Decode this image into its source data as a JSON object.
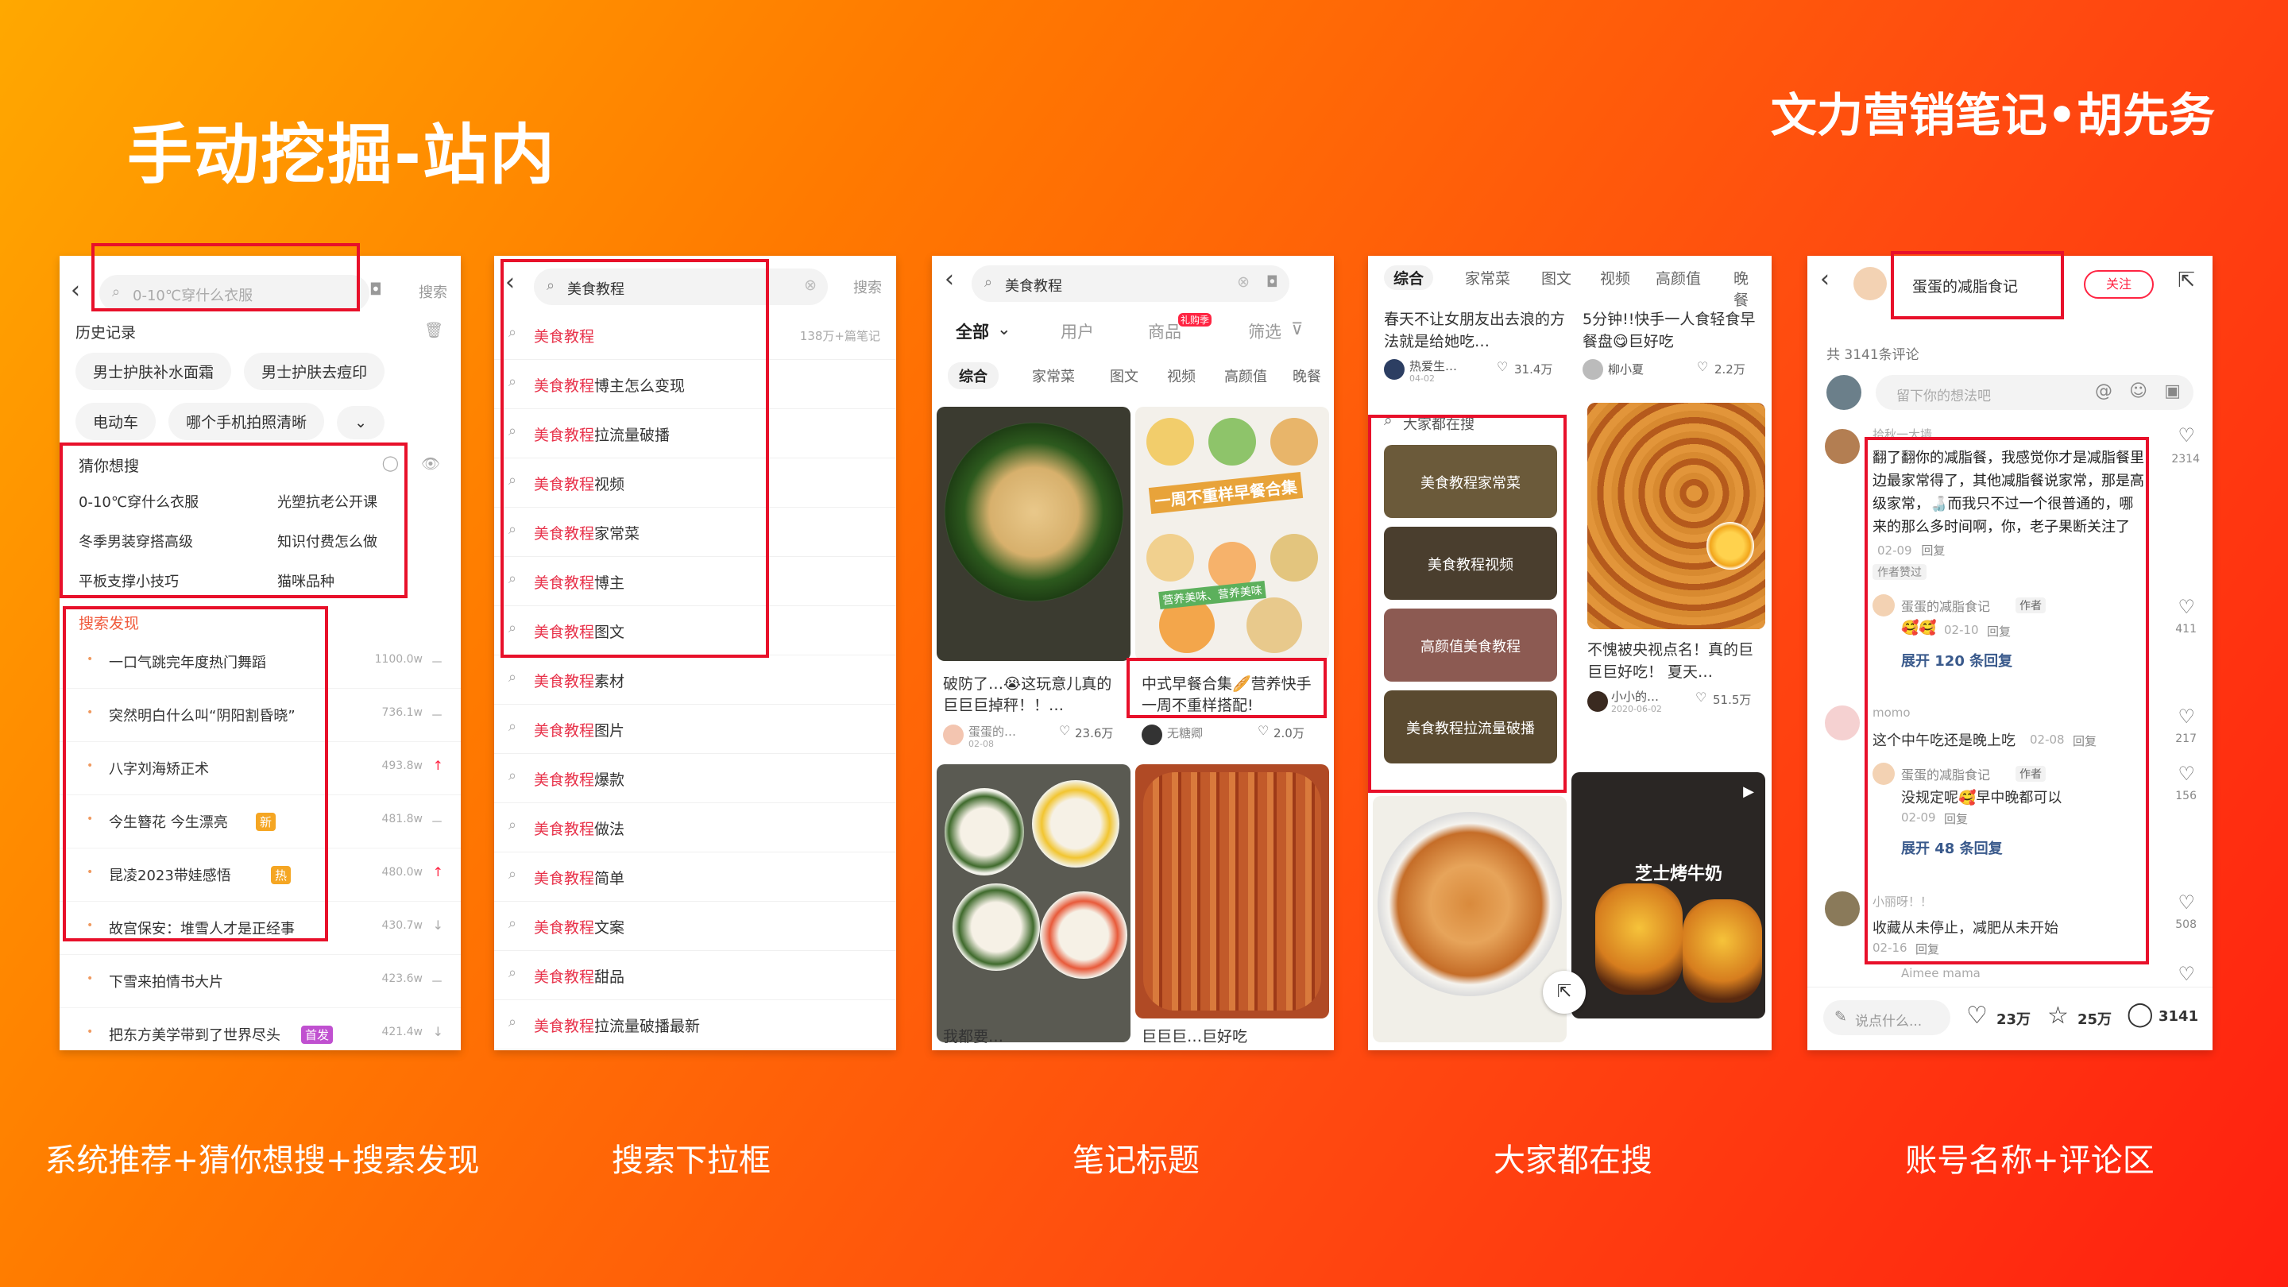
{
  "slide": {
    "title": "手动挖掘-站内",
    "brand": "文力营销笔记•胡先务",
    "captions": [
      "系统推荐+猜你想搜+搜索发现",
      "搜索下拉框",
      "笔记标题",
      "大家都在搜",
      "账号名称+评论区"
    ]
  },
  "colors": {
    "accent_red": "#e8102a",
    "keyword_red": "#e8324a",
    "bg_from": "#ffa800",
    "bg_to": "#ff2010"
  },
  "p1": {
    "placeholder": "0-10℃穿什么衣服",
    "search": "搜索",
    "history_title": "历史记录",
    "history": [
      "男士护肤补水面霜",
      "男士护肤去痘印",
      "电动车",
      "哪个手机拍照清晰"
    ],
    "guess_title": "猜你想搜",
    "guess": [
      "0-10℃穿什么衣服",
      "光塑抗老公开课",
      "冬季男装穿搭高级",
      "知识付费怎么做",
      "平板支撑小技巧",
      "猫咪品种"
    ],
    "discover_title": "搜索发现",
    "discover": [
      {
        "text": "一口气跳完年度热门舞蹈",
        "count": "1100.0w",
        "trend": "－",
        "badge": ""
      },
      {
        "text": "突然明白什么叫“阴阳割昏晓”",
        "count": "736.1w",
        "trend": "－",
        "badge": ""
      },
      {
        "text": "八字刘海矫正术",
        "count": "493.8w",
        "trend": "↑",
        "badge": ""
      },
      {
        "text": "今生簪花 今生漂亮",
        "count": "481.8w",
        "trend": "－",
        "badge": "新"
      },
      {
        "text": "昆凌2023带娃感悟",
        "count": "480.0w",
        "trend": "↑",
        "badge": "热"
      },
      {
        "text": "故宫保安：堆雪人才是正经事",
        "count": "430.7w",
        "trend": "↓",
        "badge": ""
      },
      {
        "text": "下雪来拍情书大片",
        "count": "423.6w",
        "trend": "－",
        "badge": ""
      },
      {
        "text": "把东方美学带到了世界尽头",
        "count": "421.4w",
        "trend": "↓",
        "badge": "首发"
      }
    ]
  },
  "p2": {
    "query": "美食教程",
    "search": "搜索",
    "keyword": "美食教程",
    "first_count": "138万+篇笔记",
    "suffixes": [
      "",
      "博主怎么变现",
      "拉流量破播",
      "视频",
      "家常菜",
      "博主",
      "图文",
      "素材",
      "图片",
      "爆款",
      "做法",
      "简单",
      "文案",
      "甜品",
      "拉流量破播最新"
    ]
  },
  "p3": {
    "query": "美食教程",
    "tabs": [
      "全部",
      "用户",
      "商品",
      "筛选"
    ],
    "tab_badge": "礼购季",
    "subtabs": [
      "综合",
      "家常菜",
      "图文",
      "视频",
      "高颜值",
      "晚餐"
    ],
    "cards": [
      {
        "title": "破防了…😭这玩意儿真的巨巨巨掉秤！！…",
        "author": "蛋蛋的…",
        "date": "02-08",
        "likes": "23.6万"
      },
      {
        "title": "中式早餐合集🥖营养快手一周不重样搭配!",
        "author": "无糖卿",
        "date": "",
        "likes": "2.0万"
      },
      {
        "title": "我都要…",
        "author": "",
        "date": "",
        "likes": ""
      },
      {
        "title": "巨巨巨…巨好吃",
        "author": "",
        "date": "",
        "likes": ""
      }
    ],
    "overlay": "一周不重样早餐合集",
    "overlay2": "营养美味、营养美味"
  },
  "p4": {
    "tabs": [
      "综合",
      "家常菜",
      "图文",
      "视频",
      "高颜值",
      "晚餐"
    ],
    "cards": [
      {
        "title": "春天不让女朋友出去浪的方法就是给她吃…",
        "author": "热爱生…",
        "date": "04-02",
        "likes": "31.4万"
      },
      {
        "title": "5分钟!!快手一人食轻食早餐盘😋巨好吃",
        "author": "柳小夏",
        "date": "",
        "likes": "2.2万"
      },
      {
        "title": "不愧被央视点名！真的巨巨巨好吃！ 夏天…",
        "author": "小小的…",
        "date": "2020-06-02",
        "likes": "51.5万"
      }
    ],
    "hot_title": "大家都在搜",
    "hot": [
      "美食教程家常菜",
      "美食教程视频",
      "高颜值美食教程",
      "美食教程拉流量破播"
    ],
    "overlay": "芝士烤牛奶"
  },
  "p5": {
    "account": "蛋蛋的减脂食记",
    "follow": "关注",
    "count": "共 3141条评论",
    "placeholder": "留下你的想法吧",
    "comments": [
      {
        "name": "拾秋一大墙",
        "text": "翻了翻你的减脂餐，我感觉你才是减脂餐里边最家常得了，其他减脂餐说家常，那是高级家常，🍶而我只不过一个很普通的，哪来的那么多时间啊，你，老子果断关注了",
        "date": "02-09",
        "reply": "回复",
        "badge": "作者赞过",
        "likes": "2314"
      },
      {
        "name": "蛋蛋的减脂食记",
        "role": "作者",
        "text": "🥰🥰",
        "date": "02-10",
        "reply": "回复",
        "likes": "411"
      },
      {
        "name": "momo",
        "text": "这个中午吃还是晚上吃",
        "date": "02-08",
        "reply": "回复",
        "likes": "217"
      },
      {
        "name": "蛋蛋的减脂食记",
        "role": "作者",
        "text": "没规定呢🥰早中晚都可以",
        "date": "02-09",
        "reply": "回复",
        "likes": "156"
      },
      {
        "name": "小丽呀！！",
        "text": "收藏从未停止，减肥从未开始",
        "date": "02-16",
        "reply": "回复",
        "likes": "508"
      },
      {
        "name": "Aimee mama",
        "text": "",
        "date": "",
        "reply": "",
        "likes": ""
      }
    ],
    "expand1": "展开 120 条回复",
    "expand2": "展开 48 条回复",
    "say": "说点什么...",
    "likes": "23万",
    "stars": "25万",
    "comments_count": "3141"
  }
}
